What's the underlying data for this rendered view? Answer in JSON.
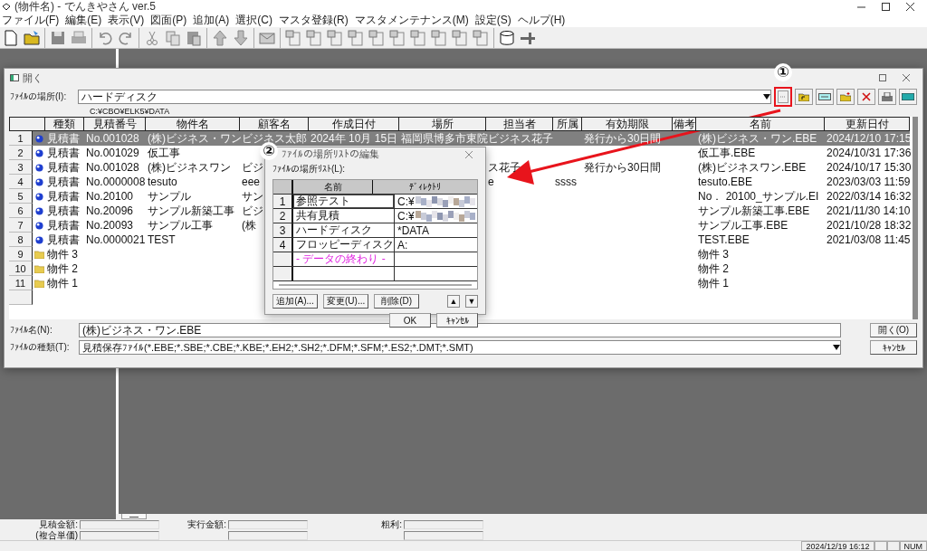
{
  "window": {
    "title": "(物件名) - でんきやさん ver.5"
  },
  "menu": [
    "ファイル(F)",
    "編集(E)",
    "表示(V)",
    "図面(P)",
    "追加(A)",
    "選択(C)",
    "マスタ登録(R)",
    "マスタメンテナンス(M)",
    "設定(S)",
    "ヘルプ(H)"
  ],
  "open_dialog": {
    "title": "開く",
    "location_label": "ﾌｧｲﾙの場所(I):",
    "location": "ハードディスク",
    "path": "C:¥CBO¥ELK5¥DATA",
    "columns": [
      "種類",
      "見積番号",
      "物件名",
      "顧客名",
      "作成日付",
      "場所",
      "担当者",
      "所属",
      "有効期限",
      "備考",
      "名前",
      "更新日付"
    ],
    "rows": [
      {
        "no": "1",
        "kind": "estimate",
        "selected": true,
        "type": "見積書",
        "number": "No.001028",
        "project": "(株)ビジネス・ワン",
        "customer": "ビジネス太郎",
        "created": "2024年 10月 15日",
        "place": "福岡県博多市東院",
        "staff": "ビジネス花子",
        "valid": "発行から30日間",
        "file": "(株)ビジネス・ワン.EBE",
        "updated": "2024/12/10 17:15"
      },
      {
        "no": "2",
        "kind": "estimate",
        "selected": false,
        "type": "見積書",
        "number": "No.001029",
        "project": "仮工事",
        "file": "仮工事.EBE",
        "updated": "2024/10/31 17:36"
      },
      {
        "no": "3",
        "kind": "estimate",
        "selected": false,
        "type": "見積書",
        "number": "No.001028",
        "project": "(株)ビジネスワン",
        "customer": "ビジ",
        "staff": "ス花子",
        "valid": "発行から30日間",
        "file": "(株)ビジネスワン.EBE",
        "updated": "2024/10/17 15:30"
      },
      {
        "no": "4",
        "kind": "estimate",
        "selected": false,
        "type": "見積書",
        "number": "No.0000008",
        "project": "tesuto",
        "customer": "eee",
        "staff": "e",
        "dept": "ssss",
        "file": "tesuto.EBE",
        "updated": "2023/03/03 11:59"
      },
      {
        "no": "5",
        "kind": "estimate",
        "selected": false,
        "type": "見積書",
        "number": "No.20100",
        "project": "サンプル",
        "customer": "サン",
        "file": "No． 20100_サンプル.EI",
        "updated": "2022/03/14 16:32"
      },
      {
        "no": "6",
        "kind": "estimate",
        "selected": false,
        "type": "見積書",
        "number": "No.20096",
        "project": "サンプル新築工事",
        "customer": "ビジ",
        "file": "サンプル新築工事.EBE",
        "updated": "2021/11/30 14:10"
      },
      {
        "no": "7",
        "kind": "estimate",
        "selected": false,
        "type": "見積書",
        "number": "No.20093",
        "project": "サンプル工事",
        "customer": "(株",
        "file": "サンプル工事.EBE",
        "updated": "2021/10/28 18:32"
      },
      {
        "no": "8",
        "kind": "estimate",
        "selected": false,
        "type": "見積書",
        "number": "No.0000021",
        "project": "TEST",
        "file": "TEST.EBE",
        "updated": "2021/03/08 11:45"
      },
      {
        "no": "9",
        "kind": "folder",
        "selected": false,
        "type": "物件 3",
        "file": "物件 3"
      },
      {
        "no": "10",
        "kind": "folder",
        "selected": false,
        "type": "物件 2",
        "file": "物件 2"
      },
      {
        "no": "11",
        "kind": "folder",
        "selected": false,
        "type": "物件 1",
        "file": "物件 1"
      }
    ],
    "filename_label": "ﾌｧｲﾙ名(N):",
    "filename": "(株)ビジネス・ワン.EBE",
    "filetype_label": "ﾌｧｲﾙの種類(T):",
    "filetype": "見積保存ﾌｧｲﾙ(*.EBE;*.SBE;*.CBE;*.KBE;*.EH2;*.SH2;*.DFM;*.SFM;*.ES2;*.DMT;*.SMT)",
    "open_button": "開く(O)",
    "cancel_button": "ｷｬﾝｾﾙ"
  },
  "location_dialog": {
    "title": "ﾌｧｲﾙの場所ﾘｽﾄの編集",
    "list_label": "ﾌｧｲﾙの場所ﾘｽﾄ(L):",
    "columns": [
      "名前",
      "ﾃﾞｨﾚｸﾄﾘ"
    ],
    "rows": [
      {
        "kind": "entry",
        "no": "1",
        "name": "参照テスト",
        "directory": "C:¥",
        "redacted": true,
        "selected": true
      },
      {
        "kind": "entry",
        "no": "2",
        "name": "共有見積",
        "directory": "C:¥",
        "redacted": true,
        "selected": false
      },
      {
        "kind": "entry",
        "no": "3",
        "name": "ハードディスク",
        "directory": "*DATA",
        "redacted": false,
        "selected": false
      },
      {
        "kind": "entry",
        "no": "4",
        "name": "フロッピーディスク",
        "directory": "A:",
        "redacted": false,
        "selected": false
      },
      {
        "kind": "end",
        "name": "- データの終わり -"
      }
    ],
    "buttons": [
      "追加(A)...",
      "変更(U)...",
      "削除(D)"
    ],
    "up": "▲",
    "down": "▼",
    "ok": "OK",
    "cancel": "ｷｬﾝｾﾙ"
  },
  "markers": [
    "①",
    "②"
  ],
  "bottom": {
    "tab": "—",
    "fields": [
      "見積金額:",
      "実行金額:",
      "粗利:"
    ],
    "second_label": "(複合単価)"
  },
  "status_bar": [
    "2024/12/19 16:12",
    "NUM"
  ]
}
